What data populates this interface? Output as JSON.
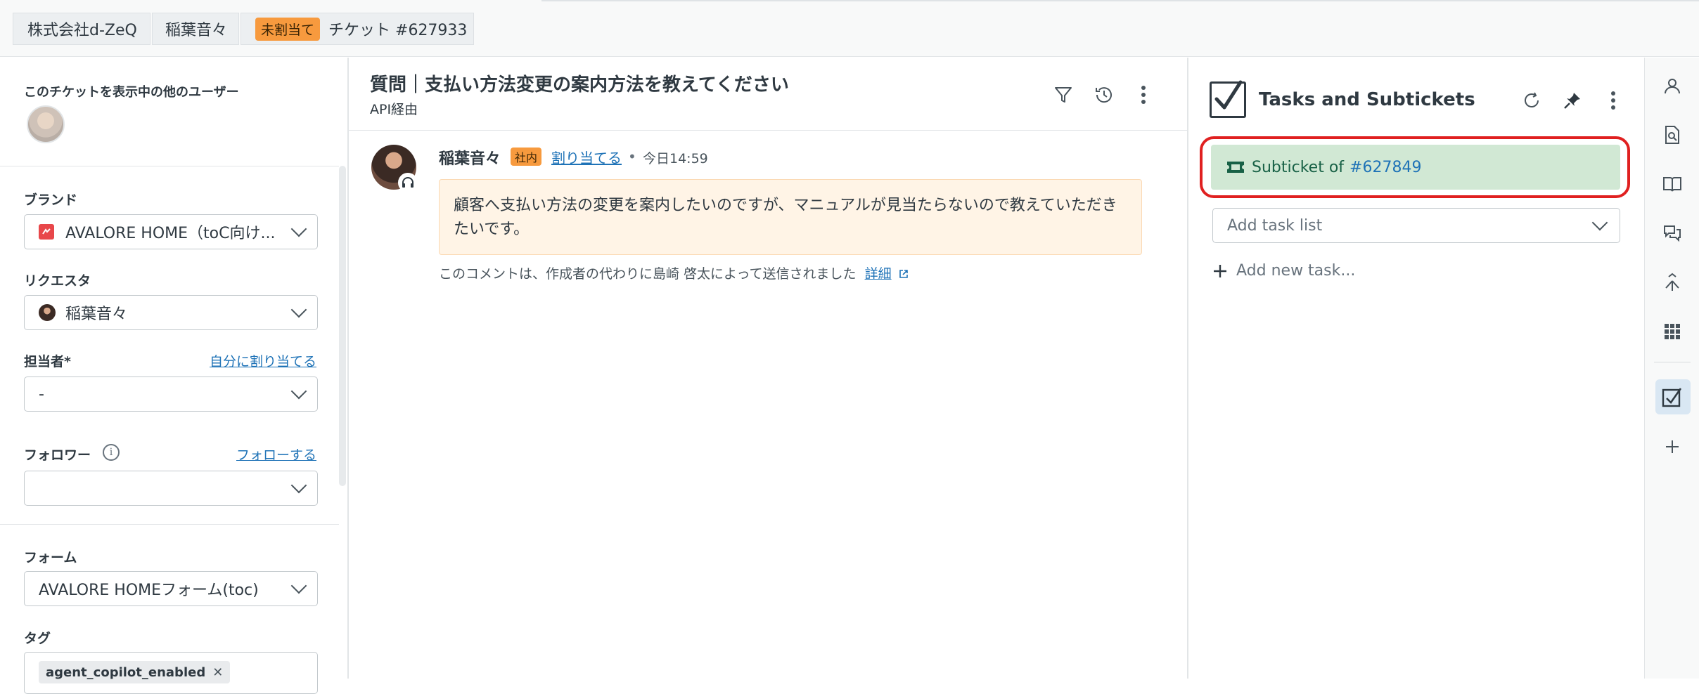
{
  "breadcrumb": {
    "company": "株式会社d-ZeQ",
    "requester": "稲葉音々",
    "status_badge": "未割当て",
    "ticket": "チケット #627933"
  },
  "left_panel": {
    "viewers_label": "このチケットを表示中の他のユーザー",
    "brand_label": "ブランド",
    "brand_value": "AVALORE HOME（toC向け...",
    "requester_label": "リクエスタ",
    "requester_value": "稲葉音々",
    "assignee_label": "担当者*",
    "assign_self_link": "自分に割り当てる",
    "assignee_value": "-",
    "followers_label": "フォロワー",
    "follow_link": "フォローする",
    "followers_value": "",
    "form_label": "フォーム",
    "form_value": "AVALORE HOMEフォーム(toc)",
    "tags_label": "タグ",
    "tag_1": "agent_copilot_enabled"
  },
  "conversation": {
    "title": "質問｜支払い方法変更の案内方法を教えてください",
    "via": "API経由",
    "message": {
      "author": "稲葉音々",
      "internal_badge": "社内",
      "assign_link": "割り当てる",
      "dot": "•",
      "time": "今日14:59",
      "body": "顧客へ支払い方法の変更を案内したいのですが、マニュアルが見当たらないので教えていただきたいです。",
      "note": "このコメントは、作成者の代わりに島崎 啓太によって送信されました",
      "detail_link": "詳細"
    }
  },
  "tasks_panel": {
    "title": "Tasks and Subtickets",
    "subticket_prefix": "Subticket of",
    "subticket_number": "#627849",
    "task_list_placeholder": "Add task list",
    "add_task": "Add new task..."
  },
  "colors": {
    "accent_link": "#1f73b7",
    "badge_orange": "#f79a3e",
    "subticket_green": "#d1e8d4",
    "highlight_red": "#e02020"
  }
}
